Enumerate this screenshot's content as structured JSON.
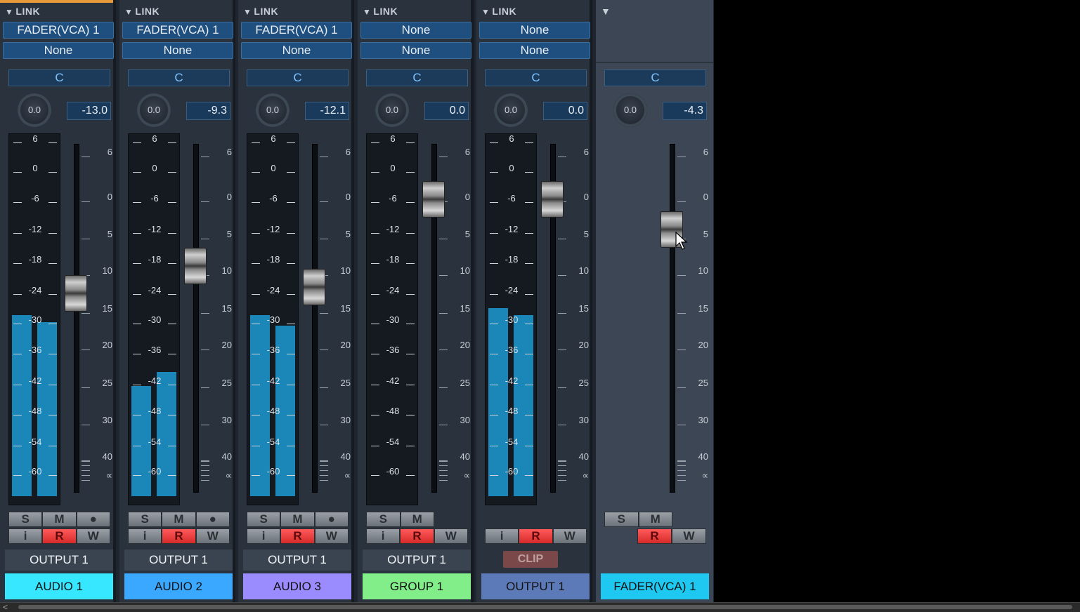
{
  "channels": [
    {
      "link": "LINK",
      "sel1": "FADER(VCA) 1",
      "sel2": "None",
      "pan": "C",
      "knob": "0.0",
      "volume": "-13.0",
      "fader_db": 13,
      "meter": [
        0.51,
        0.49
      ],
      "buttons_top": [
        "S",
        "M",
        "●"
      ],
      "buttons_bottom": [
        "i",
        "R",
        "W"
      ],
      "output": "OUTPUT 1",
      "name": "AUDIO 1",
      "color": "#37e6ff",
      "accent": "#e8993a"
    },
    {
      "link": "LINK",
      "sel1": "FADER(VCA) 1",
      "sel2": "None",
      "pan": "C",
      "knob": "0.0",
      "volume": "-9.3",
      "fader_db": 9.3,
      "meter": [
        0.31,
        0.35
      ],
      "buttons_top": [
        "S",
        "M",
        "●"
      ],
      "buttons_bottom": [
        "i",
        "R",
        "W"
      ],
      "output": "OUTPUT 1",
      "name": "AUDIO 2",
      "color": "#3aa8ff"
    },
    {
      "link": "LINK",
      "sel1": "FADER(VCA) 1",
      "sel2": "None",
      "pan": "C",
      "knob": "0.0",
      "volume": "-12.1",
      "fader_db": 12.1,
      "meter": [
        0.51,
        0.48
      ],
      "buttons_top": [
        "S",
        "M",
        "●"
      ],
      "buttons_bottom": [
        "i",
        "R",
        "W"
      ],
      "output": "OUTPUT 1",
      "name": "AUDIO 3",
      "color": "#9a8cff"
    },
    {
      "link": "LINK",
      "sel1": "None",
      "sel2": "None",
      "pan": "C",
      "knob": "0.0",
      "volume": "0.0",
      "fader_db": 0,
      "meter": [
        0,
        0
      ],
      "buttons_top": [
        "S",
        "M"
      ],
      "buttons_bottom": [
        "i",
        "R",
        "W"
      ],
      "output": "OUTPUT 1",
      "name": "GROUP 1",
      "color": "#82ee8a"
    },
    {
      "link": "LINK",
      "sel1": "None",
      "sel2": "None",
      "pan": "C",
      "knob": "0.0",
      "volume": "0.0",
      "fader_db": 0,
      "meter": [
        0.53,
        0.51
      ],
      "buttons_top": [],
      "buttons_bottom": [
        "i",
        "R",
        "W"
      ],
      "output": "",
      "clip": "CLIP",
      "name": "OUTPUT 1",
      "color": "#5c7ab8"
    },
    {
      "link": "",
      "sel1": "",
      "sel2": "",
      "pan": "C",
      "knob": "0.0",
      "volume": "-4.3",
      "fader_db": 4.3,
      "meter": null,
      "buttons_top": [
        "S",
        "M"
      ],
      "buttons_bottom": [
        "",
        "R",
        "W"
      ],
      "output": "",
      "name": "FADER(VCA) 1",
      "color": "#1fc8f0",
      "vca": true
    }
  ],
  "meter_scale": [
    "6",
    "0",
    "-6",
    "-12",
    "-18",
    "-24",
    "-30",
    "-36",
    "-42",
    "-48",
    "-54",
    "-60"
  ],
  "fader_scale": [
    "6",
    "0",
    "5",
    "10",
    "15",
    "20",
    "25",
    "30",
    "40",
    "∝"
  ]
}
